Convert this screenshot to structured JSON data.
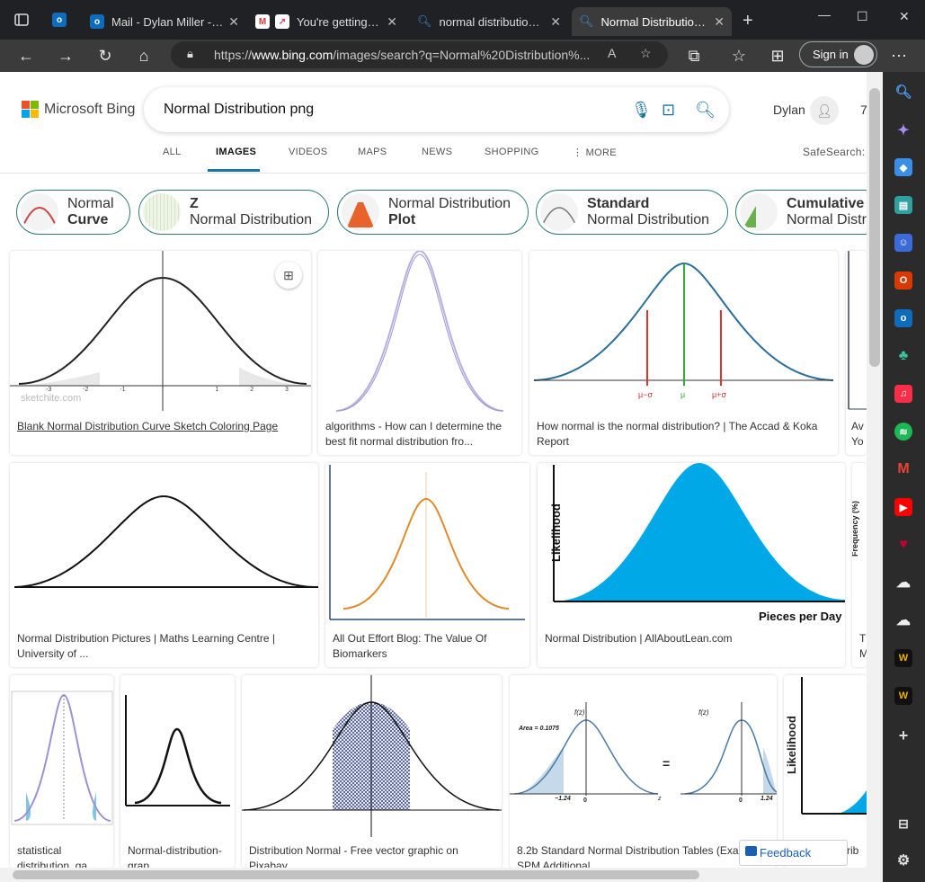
{
  "tabs": [
    {
      "label": "Mail - Dylan Miller - O",
      "icon": "outlook-icon",
      "color": "#0f6cbd"
    },
    {
      "label": "You're getting fast",
      "icon": "trending-icon",
      "color": "#e04070"
    },
    {
      "label": "normal distribution pr",
      "icon": "bing-search-icon",
      "color": "#3a8ee6"
    },
    {
      "label": "Normal Distribution p",
      "icon": "bing-search-icon",
      "color": "#3a8ee6"
    }
  ],
  "address": {
    "prefix": "https://",
    "host": "www.bing.com",
    "path": "/images/search?q=Normal%20Distribution%..."
  },
  "toolbar": {
    "signin": "Sign in"
  },
  "bing": {
    "brand": "Microsoft Bing",
    "query": "Normal Distribution png",
    "user": "Dylan",
    "user_count": "7",
    "safesearch": "SafeSearch:"
  },
  "nav": [
    "ALL",
    "IMAGES",
    "VIDEOS",
    "MAPS",
    "NEWS",
    "SHOPPING",
    "MORE"
  ],
  "chips": [
    {
      "line1": "Normal",
      "line2": "Curve",
      "bold": 2
    },
    {
      "line1": "Z",
      "line2": "Normal Distribution",
      "bold": 1
    },
    {
      "line1": "Normal Distribution",
      "line2": "Plot",
      "bold": 2
    },
    {
      "line1": "Standard",
      "line2": "Normal Distribution",
      "bold": 1
    },
    {
      "line1": "Cumulative",
      "line2": "Normal Distri",
      "bold": 1
    }
  ],
  "results": [
    {
      "caption": "Blank Normal Distribution Curve Sketch Coloring Page",
      "watermark": "sketchite.com"
    },
    {
      "caption": "algorithms - How can I determine the best fit normal distribution fro..."
    },
    {
      "caption": "How normal is the normal distribution? | The Accad & Koka Report",
      "labels": [
        "μ−σ",
        "μ",
        "μ+σ"
      ]
    },
    {
      "caption": "Ave You"
    },
    {
      "caption": "Normal Distribution Pictures | Maths Learning Centre | University of ..."
    },
    {
      "caption": "All Out Effort Blog: The Value Of Biomarkers"
    },
    {
      "caption": "Normal Distribution | AllAboutLean.com",
      "ylabel": "Likelihood",
      "xlabel": "Pieces per Day"
    },
    {
      "caption": "T M",
      "ylabel": "Frequency (%)"
    },
    {
      "caption": "statistical distribution, qa"
    },
    {
      "caption": "Normal-distribution-grap"
    },
    {
      "caption": "Distribution Normal - Free vector graphic on Pixabay"
    },
    {
      "caption": "8.2b Standard Normal Distribution Tables (Exa 1) - SPM Additional",
      "area": "Area = 0.1075",
      "fz": "f(z)",
      "z1": "−1.24",
      "z2": "1.24",
      "zero": "0",
      "z": "z",
      "eq": "="
    },
    {
      "caption": "ribu",
      "ylabel": "Likelihood"
    }
  ],
  "feedback": "Feedback",
  "axis_ticks": [
    "-3",
    "-2",
    "-1",
    "1",
    "2",
    "3"
  ]
}
